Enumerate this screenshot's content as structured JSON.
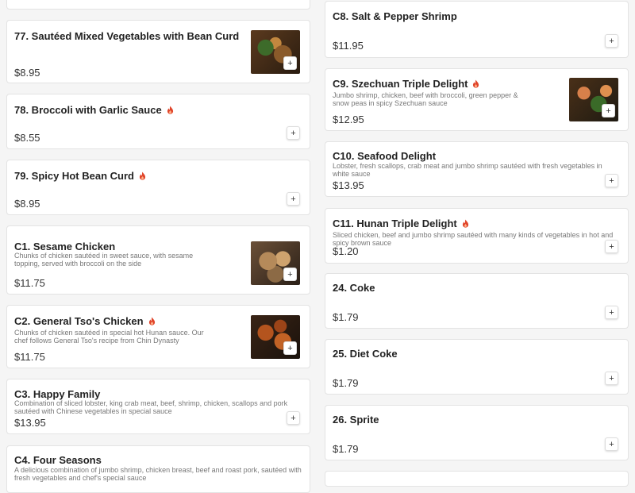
{
  "left_items": [
    {
      "name": "77. Sautéed Mixed Vegetables with Bean Curd",
      "desc": "",
      "price": "$8.95",
      "spicy": false,
      "image": "food1"
    },
    {
      "name": "78. Broccoli with Garlic Sauce",
      "desc": "",
      "price": "$8.55",
      "spicy": true,
      "image": ""
    },
    {
      "name": "79. Spicy Hot Bean Curd",
      "desc": "",
      "price": "$8.95",
      "spicy": true,
      "image": ""
    },
    {
      "name": "C1. Sesame Chicken",
      "desc": "Chunks of chicken sautéed in sweet sauce, with sesame topping, served with broccoli on the side",
      "price": "$11.75",
      "spicy": false,
      "image": "food3"
    },
    {
      "name": "C2. General Tso's Chicken",
      "desc": "Chunks of chicken sautéed in special hot Hunan sauce. Our chef follows General Tso's recipe from Chin Dynasty",
      "price": "$11.75",
      "spicy": true,
      "image": "food4"
    },
    {
      "name": "C3. Happy Family",
      "desc": "Combination of sliced lobster, king crab meat, beef, shrimp, chicken, scallops and pork sautéed with Chinese vegetables in special sauce",
      "price": "$13.95",
      "spicy": false,
      "image": ""
    },
    {
      "name": "C4. Four Seasons",
      "desc": "A delicious combination of jumbo shrimp, chicken breast, beef and roast pork, sautéed with fresh vegetables and chef's special sauce",
      "price": "",
      "spicy": false,
      "image": ""
    }
  ],
  "right_items": [
    {
      "name": "C8. Salt & Pepper Shrimp",
      "desc": "",
      "price": "$11.95",
      "spicy": false,
      "image": ""
    },
    {
      "name": "C9. Szechuan Triple Delight",
      "desc": "Jumbo shrimp, chicken, beef with broccoli, green pepper & snow peas in spicy Szechuan sauce",
      "price": "$12.95",
      "spicy": true,
      "image": "food2"
    },
    {
      "name": "C10. Seafood Delight",
      "desc": "Lobster, fresh scallops, crab meat and jumbo shrimp sautéed with fresh vegetables in white sauce",
      "price": "$13.95",
      "spicy": false,
      "image": ""
    },
    {
      "name": "C11. Hunan Triple Delight",
      "desc": "Sliced chicken, beef and jumbo shrimp sautéed with many kinds of vegetables in hot and spicy brown sauce",
      "price": "$1.20",
      "spicy": true,
      "image": ""
    },
    {
      "name": "24. Coke",
      "desc": "",
      "price": "$1.79",
      "spicy": false,
      "image": ""
    },
    {
      "name": "25. Diet Coke",
      "desc": "",
      "price": "$1.79",
      "spicy": false,
      "image": ""
    },
    {
      "name": "26. Sprite",
      "desc": "",
      "price": "$1.79",
      "spicy": false,
      "image": ""
    }
  ],
  "icons": {
    "add": "plus-icon",
    "spicy": "chili-flame-icon"
  },
  "colors": {
    "spicy": "#e0452b",
    "card_bg": "#ffffff",
    "page_bg": "#f5f5f5"
  },
  "add_symbol": "+"
}
